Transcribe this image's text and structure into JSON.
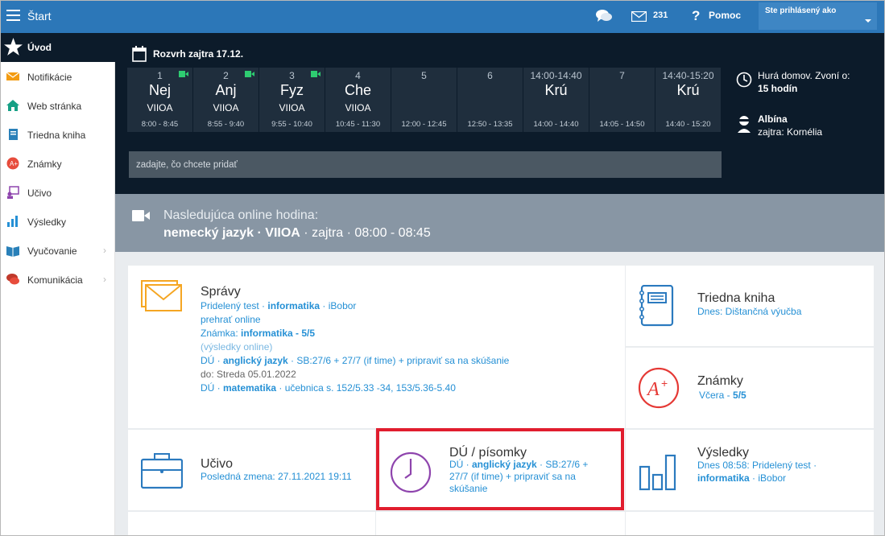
{
  "topbar": {
    "title": "Štart",
    "mail_count": "231",
    "help_label": "Pomoc",
    "user_label": "Ste prihlásený ako"
  },
  "sidebar": {
    "active": "Úvod",
    "items": [
      {
        "label": "Notifikácie",
        "icon": "envelope-icon",
        "color": "#f39c12"
      },
      {
        "label": "Web stránka",
        "icon": "home-icon",
        "color": "#16a085"
      },
      {
        "label": "Triedna kniha",
        "icon": "book-icon",
        "color": "#2980b9"
      },
      {
        "label": "Známky",
        "icon": "grade-icon",
        "color": "#e74c3c"
      },
      {
        "label": "Učivo",
        "icon": "teacher-icon",
        "color": "#8e44ad"
      },
      {
        "label": "Výsledky",
        "icon": "chart-icon",
        "color": "#2590d5"
      },
      {
        "label": "Vyučovanie",
        "icon": "open-book-icon",
        "color": "#2980b9"
      },
      {
        "label": "Komunikácia",
        "icon": "chat-icon",
        "color": "#c0392b"
      }
    ]
  },
  "schedule": {
    "title": "Rozvrh zajtra 17.12.",
    "cells": [
      {
        "num": "1",
        "subject": "Nej",
        "class": "VIIOA",
        "time": "8:00 - 8:45",
        "online": true
      },
      {
        "num": "2",
        "subject": "Anj",
        "class": "VIIOA",
        "time": "8:55 - 9:40",
        "online": true
      },
      {
        "num": "3",
        "subject": "Fyz",
        "class": "VIIOA",
        "time": "9:55 - 10:40",
        "online": true
      },
      {
        "num": "4",
        "subject": "Che",
        "class": "VIIOA",
        "time": "10:45 - 11:30",
        "online": false
      },
      {
        "num": "5",
        "subject": "",
        "class": "",
        "time": "12:00 - 12:45",
        "online": false
      },
      {
        "num": "6",
        "subject": "",
        "class": "",
        "time": "12:50 - 13:35",
        "online": false
      },
      {
        "num": "14:00-14:40",
        "subject": "Krú",
        "class": "",
        "time": "14:00 - 14:40",
        "online": false
      },
      {
        "num": "7",
        "subject": "",
        "class": "",
        "time": "14:05 - 14:50",
        "online": false
      },
      {
        "num": "14:40-15:20",
        "subject": "Krú",
        "class": "",
        "time": "14:40 - 15:20",
        "online": false
      }
    ],
    "home_line1": "Hurá domov. Zvoní o:",
    "home_line2": "15 hodín",
    "person_name": "Albína",
    "person_line": "zajtra: Kornélia",
    "add_placeholder": "zadajte, čo chcete pridať"
  },
  "banner": {
    "line1": "Nasledujúca online hodina:",
    "subject": "nemecký jazyk · VIIOA",
    "when": " · zajtra · 08:00 - 08:45"
  },
  "cards": {
    "spravy": {
      "title": "Správy",
      "l1a": "Pridelený test · ",
      "l1b": "informatika",
      "l1c": " · iBobor",
      "l2": "prehrať online",
      "l3a": "Známka: ",
      "l3b": "informatika - 5/5",
      "l4": "(výsledky online)",
      "l5a": "DÚ · ",
      "l5b": "anglický jazyk",
      "l5c": " · SB:27/6 + 27/7 (if time) + pripraviť sa na skúšanie",
      "l6": "do: Streda 05.01.2022",
      "l7a": "DÚ · ",
      "l7b": "matematika",
      "l7c": " · učebnica s. 152/5.33 -34, 153/5.36-5.40"
    },
    "triedna": {
      "title": "Triedna kniha",
      "sub": "Dnes: Dištančná výučba"
    },
    "znamky": {
      "title": "Známky",
      "suba": "Včera - ",
      "subb": "5/5"
    },
    "ucivo": {
      "title": "Učivo",
      "sub": "Posledná zmena: 27.11.2021 19:11"
    },
    "du": {
      "title": "DÚ / písomky",
      "a": "DÚ · ",
      "b": "anglický jazyk",
      "c": " · SB:27/6 +",
      "d": "27/7 (if time) + pripraviť sa na",
      "e": "skúšanie"
    },
    "vysledky": {
      "title": "Výsledky",
      "l1": "Dnes 08:58: Pridelený test ·",
      "l2a": "informatika",
      "l2b": " · iBobor"
    }
  },
  "colors": {
    "topbar": "#2c77b8",
    "dark": "#0c1b2a",
    "accent": "#2590d5",
    "highlight": "#e11d2e"
  }
}
